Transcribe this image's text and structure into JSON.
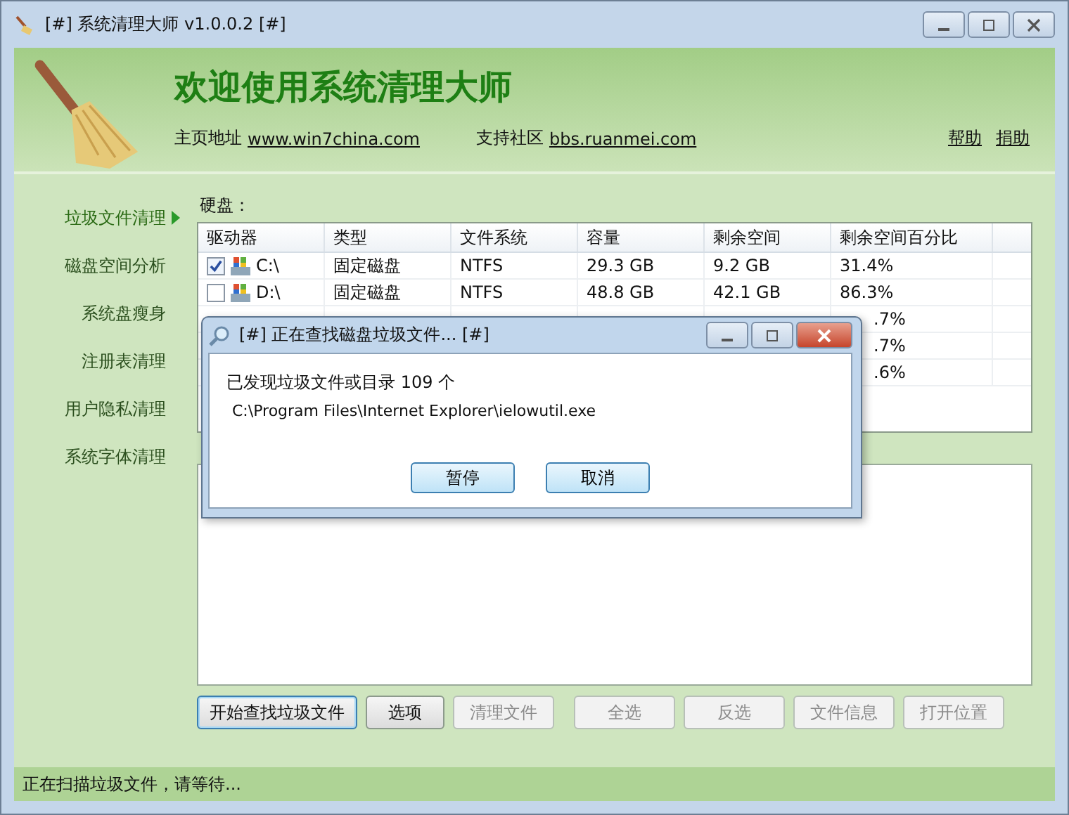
{
  "window": {
    "title": "[#] 系统清理大师 v1.0.0.2 [#]"
  },
  "header": {
    "title": "欢迎使用系统清理大师",
    "homepage_label": "主页地址",
    "homepage_link": "www.win7china.com",
    "community_label": "支持社区",
    "community_link": "bbs.ruanmei.com",
    "links": [
      "帮助",
      "捐助"
    ]
  },
  "sidebar": {
    "items": [
      {
        "label": "垃圾文件清理",
        "selected": true
      },
      {
        "label": "磁盘空间分析",
        "selected": false
      },
      {
        "label": "系统盘瘦身",
        "selected": false
      },
      {
        "label": "注册表清理",
        "selected": false
      },
      {
        "label": "用户隐私清理",
        "selected": false
      },
      {
        "label": "系统字体清理",
        "selected": false
      }
    ]
  },
  "disk_section": {
    "label": "硬盘：",
    "columns": [
      "驱动器",
      "类型",
      "文件系统",
      "容量",
      "剩余空间",
      "剩余空间百分比"
    ],
    "rows": [
      {
        "checked": true,
        "drive": "C:\\",
        "type": "固定磁盘",
        "fs": "NTFS",
        "capacity": "29.3 GB",
        "free": "9.2 GB",
        "percent": "31.4%"
      },
      {
        "checked": false,
        "drive": "D:\\",
        "type": "固定磁盘",
        "fs": "NTFS",
        "capacity": "48.8 GB",
        "free": "42.1 GB",
        "percent": "86.3%"
      },
      {
        "percent": ".7%"
      },
      {
        "percent": ".7%"
      },
      {
        "percent": ".6%"
      }
    ]
  },
  "buttons": [
    {
      "label": "开始查找垃圾文件",
      "disabled": false
    },
    {
      "label": "选项",
      "disabled": false
    },
    {
      "label": "清理文件",
      "disabled": true
    },
    {
      "label": "全选",
      "disabled": true
    },
    {
      "label": "反选",
      "disabled": true
    },
    {
      "label": "文件信息",
      "disabled": true
    },
    {
      "label": "打开位置",
      "disabled": true
    }
  ],
  "status_bar": "正在扫描垃圾文件，请等待...",
  "dialog": {
    "title": "[#] 正在查找磁盘垃圾文件... [#]",
    "message": "已发现垃圾文件或目录 109 个",
    "path": "C:\\Program Files\\Internet Explorer\\ielowutil.exe",
    "buttons": [
      "暂停",
      "取消"
    ]
  }
}
